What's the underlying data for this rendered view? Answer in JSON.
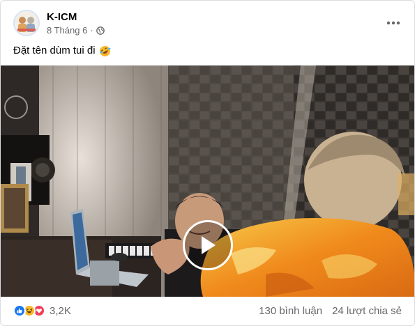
{
  "post": {
    "page_name": "K-ICM",
    "date": "8 Tháng 6",
    "separator": "·",
    "caption": "Đặt tên dùm tui đi",
    "caption_emoji": "rolling-on-floor-laughing-emoji",
    "privacy_icon": "globe-icon",
    "more_icon": "more-options-icon"
  },
  "video": {
    "play_icon": "play-icon"
  },
  "stats": {
    "reaction_icons": [
      "like-icon",
      "haha-icon",
      "love-icon"
    ],
    "reaction_count": "3,2K",
    "comments": "130 bình luận",
    "shares": "24 lượt chia sẻ"
  },
  "colors": {
    "text_primary": "#050505",
    "text_secondary": "#65676b",
    "like_blue": "#1877f2",
    "love_red": "#f33e58",
    "haha_yellow": "#f7b928"
  }
}
